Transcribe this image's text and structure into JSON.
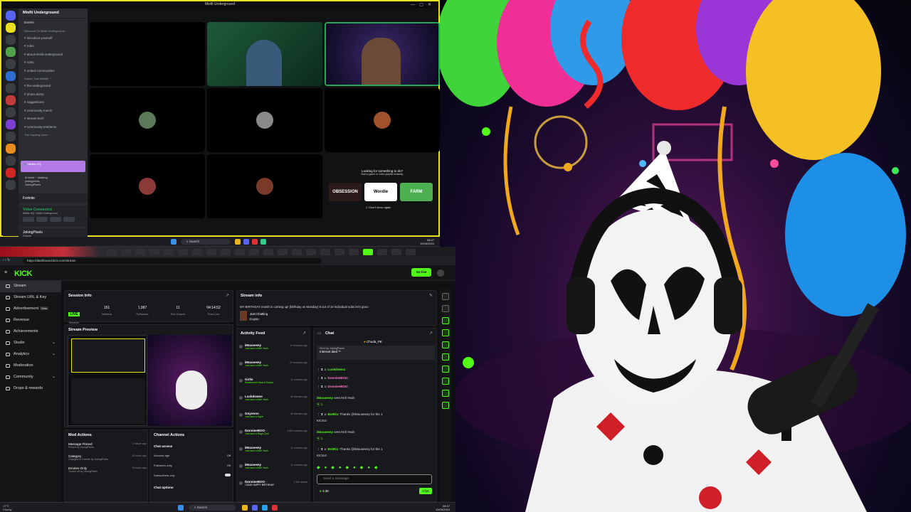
{
  "discord": {
    "title": "Misfit Underground",
    "server_name": "Misfit Underground",
    "events_label": "Events",
    "categories": [
      {
        "label": "Welcome To Misfit Underground ~",
        "channels": [
          "introduce-yourself",
          "rules",
          "about-misfit-underground",
          "roles",
          "united communities"
        ]
      },
      {
        "label": "Voices That Matter! ~",
        "channels": [
          "the-underground",
          "photo-dump",
          "suggestions",
          "community-merch",
          "stream-tech",
          "community-emblems"
        ]
      },
      {
        "label": "The Vapping Zone ~",
        "channels": []
      }
    ],
    "voice_channel": "Misfits HQ",
    "voice_users": [
      "lil moist ~ shaking",
      "jokingpixels",
      "JokingPixels"
    ],
    "activity_game": "Fortnite",
    "connection": {
      "status": "Video Connected",
      "detail": "Misfits HQ / Misfit Underground"
    },
    "user": {
      "name": "JokingPixels",
      "status": "Fortnite"
    },
    "activity_panel": {
      "heading": "Looking for something to do?",
      "subheading": "Start a game or video playlist instantly.",
      "games": [
        "OBSESSION",
        "Wordle",
        "FARM"
      ],
      "checkbox": "Don't show again"
    }
  },
  "taskbar_top": {
    "search": "Search",
    "time": "08:47",
    "date": "10/06/2024"
  },
  "browser": {
    "url": "https://dashboard.kick.com/stream",
    "go_live": "Go live"
  },
  "kick": {
    "logo": "KICK",
    "nav": [
      {
        "label": "Stream",
        "active": true,
        "badge": "",
        "chevron": false
      },
      {
        "label": "Stream URL & Key",
        "active": false,
        "badge": "",
        "chevron": false
      },
      {
        "label": "Advertisement",
        "active": false,
        "badge": "Beta",
        "chevron": false
      },
      {
        "label": "Revenue",
        "active": false,
        "badge": "",
        "chevron": false
      },
      {
        "label": "Achievements",
        "active": false,
        "badge": "",
        "chevron": false
      },
      {
        "label": "Studio",
        "active": false,
        "badge": "",
        "chevron": true
      },
      {
        "label": "Analytics",
        "active": false,
        "badge": "",
        "chevron": true
      },
      {
        "label": "Moderation",
        "active": false,
        "badge": "",
        "chevron": false
      },
      {
        "label": "Community",
        "active": false,
        "badge": "",
        "chevron": true
      },
      {
        "label": "Drops & rewards",
        "active": false,
        "badge": "",
        "chevron": false
      }
    ],
    "session_info": {
      "title": "Session Info",
      "stats": [
        {
          "value": "LIVE",
          "label": "Session"
        },
        {
          "value": "151",
          "label": "Viewers"
        },
        {
          "value": "1,997",
          "label": "Followers"
        },
        {
          "value": "11",
          "label": "Sub Counts"
        },
        {
          "value": "04:14:52",
          "label": "Time Live"
        }
      ]
    },
    "stream_preview": {
      "title": "Stream Preview"
    },
    "stream_info": {
      "title": "Stream info",
      "headline": "MY BIRTHDAY month is coming up! (birthday on Monday) 8 out of 10 individual subs let's gooo",
      "category": "Just Chatting",
      "language": "English"
    },
    "activity_feed": {
      "title": "Activity Feed",
      "items": [
        {
          "user": "iMouseeey",
          "detail": "Just sent a Hell Yeah",
          "time": "10 seconds ago"
        },
        {
          "user": "iMouseeey",
          "detail": "Just sent a Hell Yeah",
          "time": "22 seconds ago"
        },
        {
          "user": "Girlis",
          "detail": "Redeemed Hava A Snack",
          "time": "11 minutes ago"
        },
        {
          "user": "Luckdowne",
          "detail": "Just sent a Hell Yeah",
          "time": "40 minutes ago"
        },
        {
          "user": "Goyonon",
          "detail": "Just sent a Hype",
          "time": "40 minutes ago"
        },
        {
          "user": "DonnieeBOO",
          "detail": "Just sent a Rage Quit",
          "time": "1,900 minutes ago"
        },
        {
          "user": "iMouseeey",
          "detail": "Just sent a Hell Yeah",
          "time": "11 minutes ago"
        },
        {
          "user": "iMouseeey",
          "detail": "Just sent a Hell Yeah",
          "time": "11 minutes ago"
        },
        {
          "user": "DonnieeBOO",
          "detail": "I SAID HAPPY BIRTHDAY",
          "time": "1,100 weeks"
        }
      ]
    },
    "chat": {
      "title": "Chat",
      "pinned_user": "Chuda_PE",
      "sent_by": "Sent by  JokingPixels",
      "pinned_text": "Internet died **",
      "lines": [
        {
          "user": "Luckdownc",
          "text": "",
          "style": "u"
        },
        {
          "user": "DonnieeBOO",
          "text": "",
          "style": "p"
        },
        {
          "user": "DonnieeBOO",
          "text": "",
          "style": "p"
        },
        {
          "user": "iMouseeey",
          "text": "sent Hell Yeah",
          "style": "u"
        },
        {
          "user": "",
          "text": "1",
          "style": "u"
        },
        {
          "user": "BotRix",
          "text": "Thanks @iMouseeey for the 1",
          "style": "u"
        },
        {
          "user": "",
          "text": "KICKs!",
          "style": "u"
        },
        {
          "user": "iMouseeey",
          "text": "sent Hell Yeah",
          "style": "u"
        },
        {
          "user": "",
          "text": "1",
          "style": "u"
        },
        {
          "user": "BotRix",
          "text": "Thanks @iMouseeey for the 1",
          "style": "u"
        },
        {
          "user": "",
          "text": "KICKs!",
          "style": "u"
        }
      ],
      "input_placeholder": "Send a message",
      "kicks": "3.3K",
      "send": "Chat"
    },
    "mod_actions": {
      "title": "Mod Actions",
      "items": [
        {
          "action": "Message Pinned",
          "by": "Pinned by JokingPixels",
          "time": "1 minute ago"
        },
        {
          "action": "Category",
          "by": "Changed to Fortnite by JokingPixels",
          "time": "16 hours ago"
        },
        {
          "action": "Emotes-Only",
          "by": "Turned off by JokingPixels",
          "time": "16 hours ago"
        }
      ]
    },
    "channel_actions": {
      "title": "Channel Actions",
      "section1": "Chat access",
      "rows": [
        {
          "label": "Account age",
          "value": "Off"
        },
        {
          "label": "Followers only",
          "value": "Off"
        },
        {
          "label": "Subscribers only",
          "value": ""
        }
      ],
      "section2": "Chat options"
    }
  },
  "taskbar_bottom": {
    "weather_temp": "17°C",
    "weather_desc": "Cloudy",
    "search": "Search",
    "time": "08:47",
    "date": "10/06/2024"
  }
}
